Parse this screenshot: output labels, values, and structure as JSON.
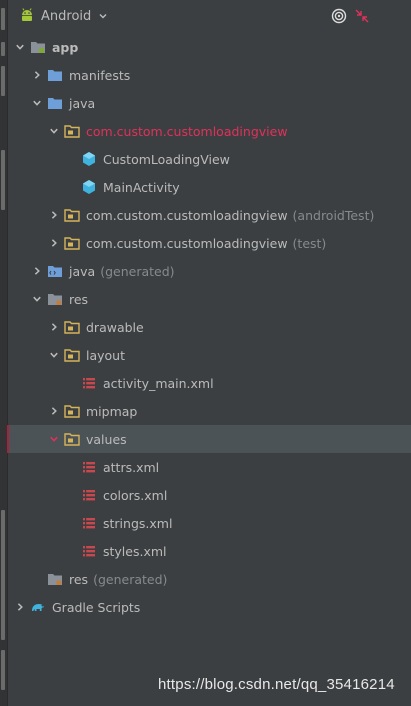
{
  "toolbar": {
    "view_title": "Android",
    "icons": [
      "android-icon",
      "chevron-down-icon",
      "target-icon",
      "collapse-icon"
    ]
  },
  "tree": {
    "rows": [
      {
        "label": "app",
        "icon": "module-folder",
        "arrow": "down",
        "depth": 0,
        "bold": true
      },
      {
        "label": "manifests",
        "icon": "folder",
        "arrow": "right",
        "depth": 1
      },
      {
        "label": "java",
        "icon": "folder",
        "arrow": "down",
        "depth": 1
      },
      {
        "label": "com.custom.customloadingview",
        "icon": "package",
        "arrow": "down",
        "depth": 2,
        "accent": "pink"
      },
      {
        "label": "CustomLoadingView",
        "icon": "class",
        "arrow": "none",
        "depth": 3
      },
      {
        "label": "MainActivity",
        "icon": "class",
        "arrow": "none",
        "depth": 3
      },
      {
        "label": "com.custom.customloadingview",
        "suffix": "(androidTest)",
        "icon": "package",
        "arrow": "right",
        "depth": 2
      },
      {
        "label": "com.custom.customloadingview",
        "suffix": "(test)",
        "icon": "package",
        "arrow": "right",
        "depth": 2
      },
      {
        "label": "java",
        "suffix": "(generated)",
        "icon": "generated-folder",
        "arrow": "right",
        "depth": 1
      },
      {
        "label": "res",
        "icon": "res-folder",
        "arrow": "down",
        "depth": 1
      },
      {
        "label": "drawable",
        "icon": "package",
        "arrow": "right",
        "depth": 2
      },
      {
        "label": "layout",
        "icon": "package",
        "arrow": "down",
        "depth": 2
      },
      {
        "label": "activity_main.xml",
        "icon": "xml-file",
        "arrow": "none",
        "depth": 3
      },
      {
        "label": "mipmap",
        "icon": "package",
        "arrow": "right",
        "depth": 2
      },
      {
        "label": "values",
        "icon": "package",
        "arrow": "down",
        "depth": 2,
        "selected": true
      },
      {
        "label": "attrs.xml",
        "icon": "xml-file",
        "arrow": "none",
        "depth": 3
      },
      {
        "label": "colors.xml",
        "icon": "xml-file",
        "arrow": "none",
        "depth": 3
      },
      {
        "label": "strings.xml",
        "icon": "xml-file",
        "arrow": "none",
        "depth": 3
      },
      {
        "label": "styles.xml",
        "icon": "xml-file",
        "arrow": "none",
        "depth": 3
      },
      {
        "label": "res",
        "suffix": "(generated)",
        "icon": "res-folder",
        "arrow": "none",
        "depth": 1
      },
      {
        "label": "Gradle Scripts",
        "icon": "gradle",
        "arrow": "right",
        "depth": 0
      }
    ]
  },
  "watermark": "https://blog.csdn.net/qq_35416214",
  "colors": {
    "background": "#3c3f41",
    "selection": "#4b5357",
    "selection_bar": "#a3243c",
    "accent_pink": "#e1315b",
    "folder_blue": "#6e9fd8",
    "package_yellow": "#d6b45a",
    "class_cyan": "#3fb3de",
    "xml_red": "#c9484e",
    "android_green": "#a4c639"
  }
}
